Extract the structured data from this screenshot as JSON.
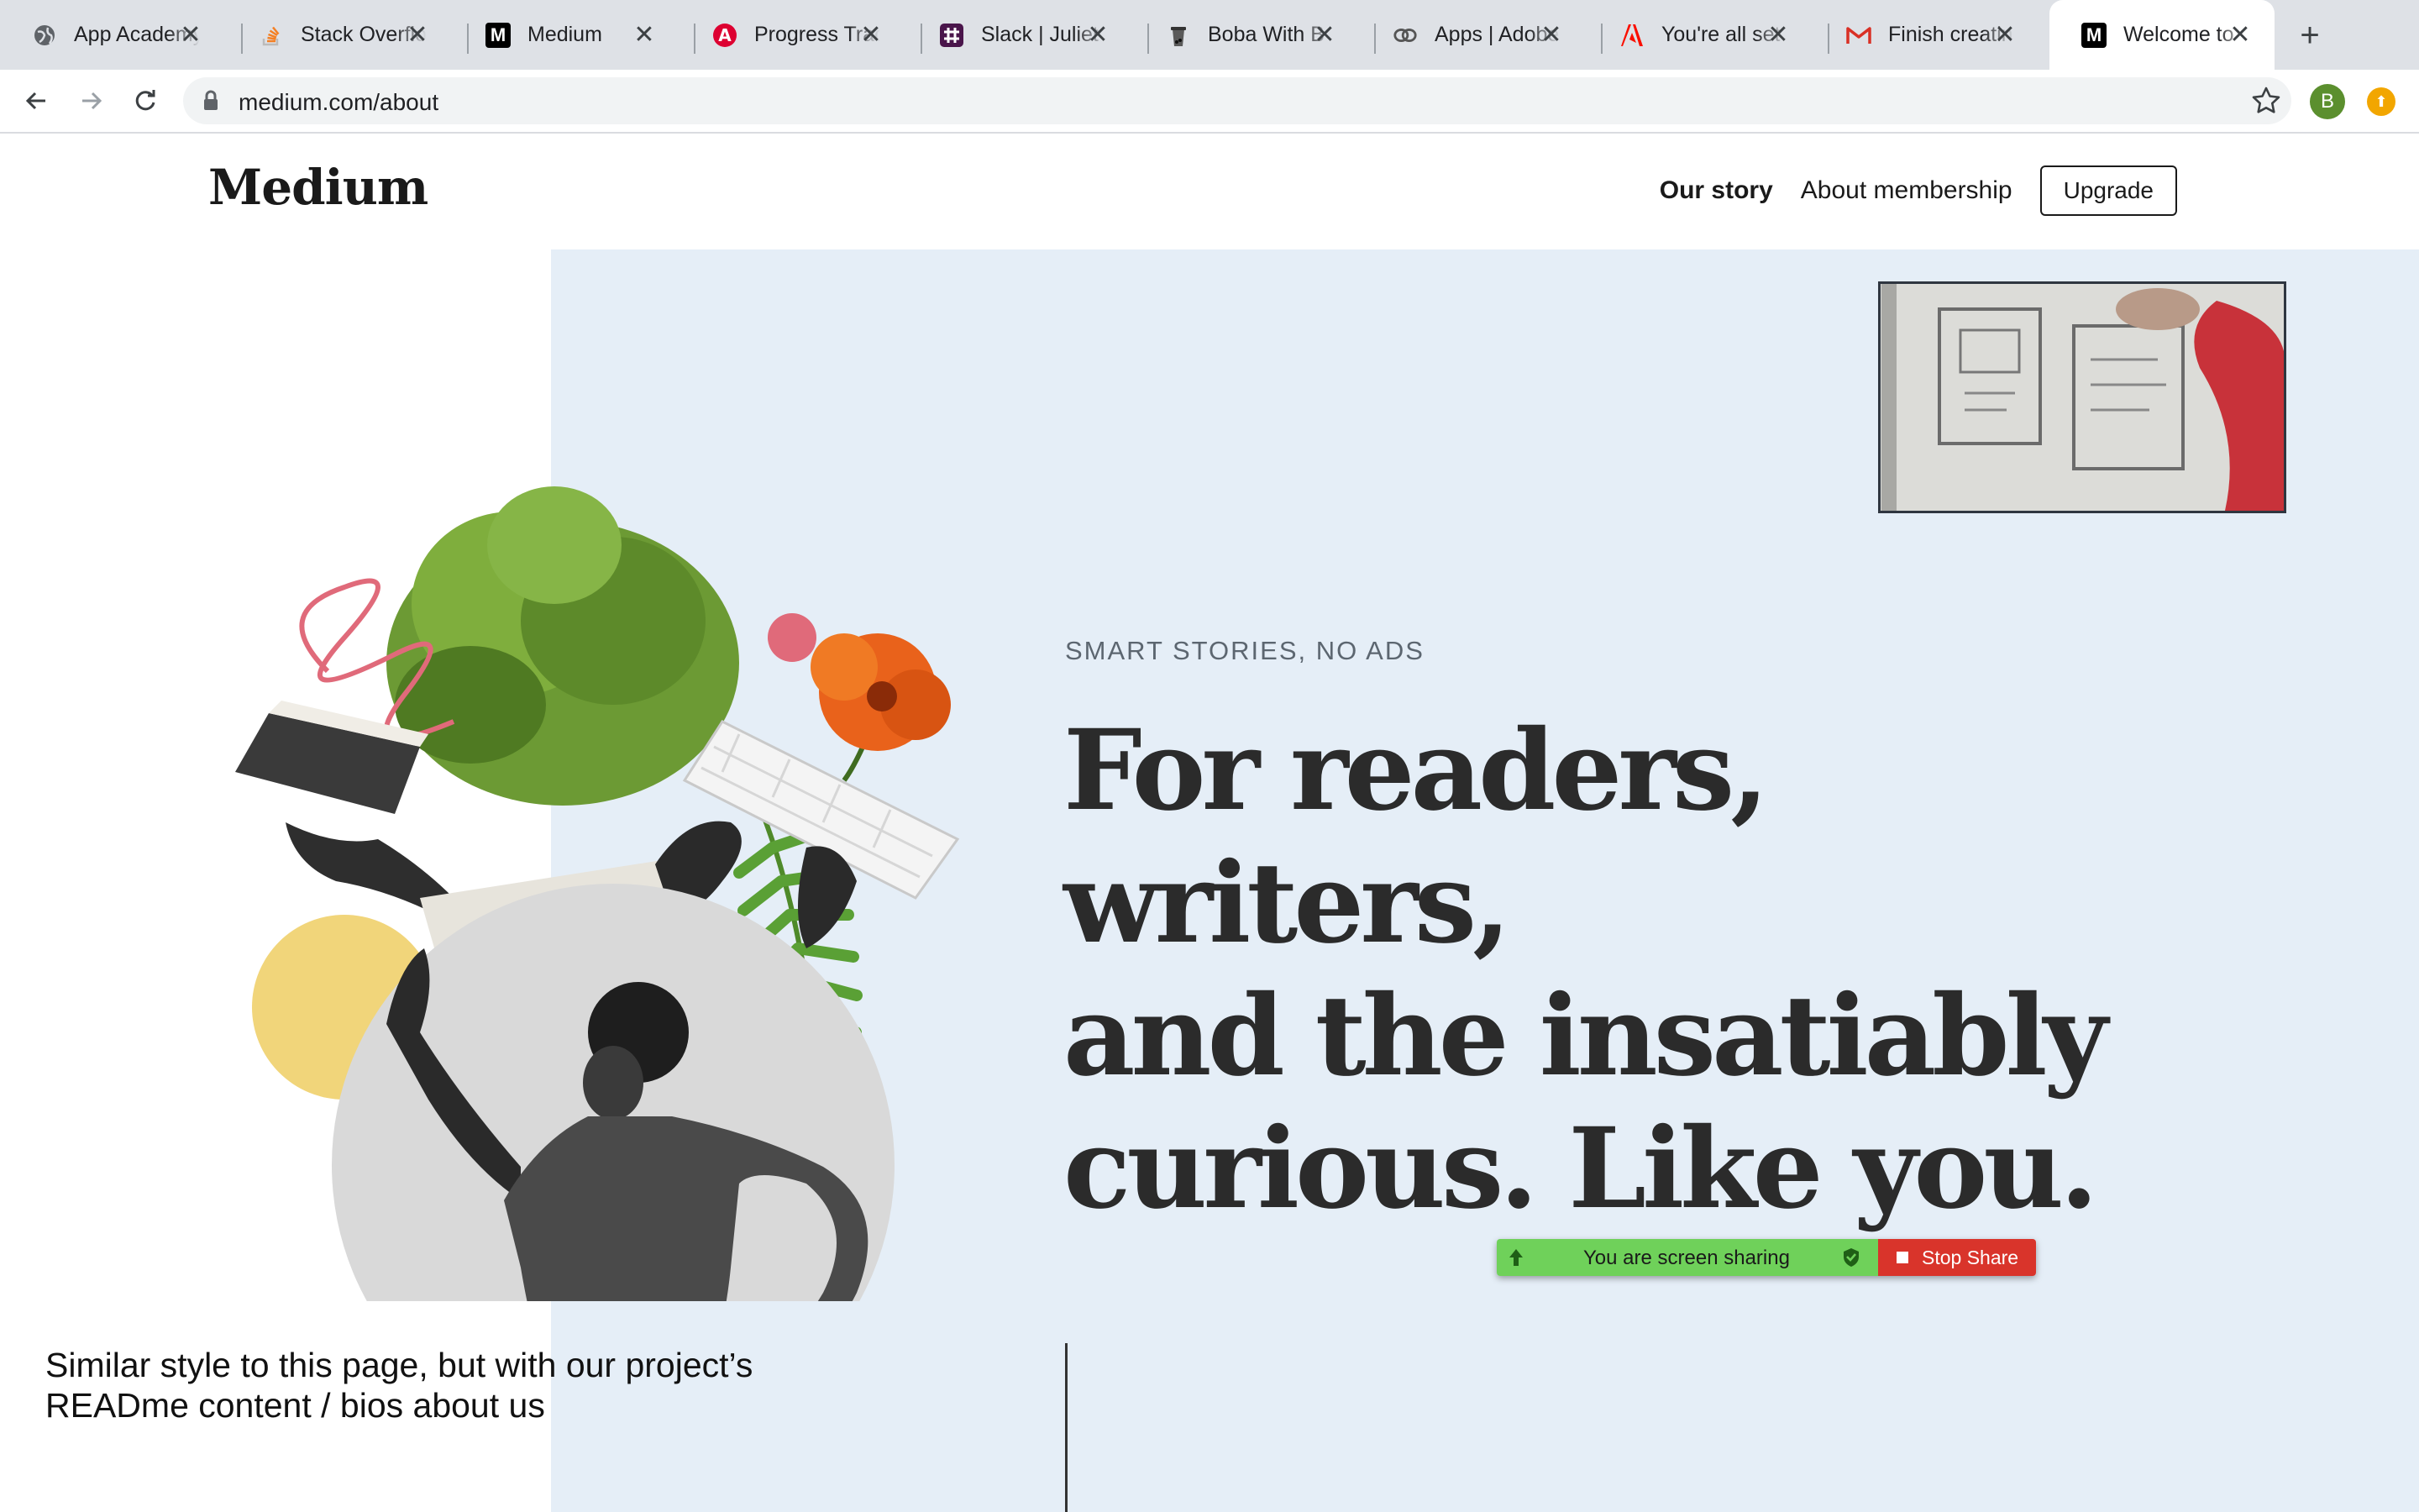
{
  "browser": {
    "tabs": [
      {
        "title": "App Academy",
        "icon": "globe-icon"
      },
      {
        "title": "Stack Overflow",
        "icon": "stackoverflow-icon"
      },
      {
        "title": "Medium",
        "icon": "medium-icon"
      },
      {
        "title": "Progress Tracker",
        "icon": "angular-icon"
      },
      {
        "title": "Slack | Juliet",
        "icon": "slack-icon"
      },
      {
        "title": "Boba With B",
        "icon": "boba-icon"
      },
      {
        "title": "Apps | Adobe",
        "icon": "creative-cloud-icon"
      },
      {
        "title": "You're all set",
        "icon": "adobe-icon"
      },
      {
        "title": "Finish creating",
        "icon": "gmail-icon"
      },
      {
        "title": "Welcome to",
        "icon": "medium-icon",
        "active": true
      }
    ],
    "url": "medium.com/about",
    "profile_initial": "B"
  },
  "site": {
    "logo": "Medium",
    "nav": {
      "our_story": "Our story",
      "membership": "About membership",
      "upgrade": "Upgrade"
    }
  },
  "hero": {
    "eyebrow": "SMART STORIES, NO ADS",
    "headline_lines": [
      "For readers, writers,",
      "and the insatiably",
      "curious. Like you."
    ]
  },
  "screen_share": {
    "status": "You are screen sharing",
    "stop_label": "Stop Share"
  },
  "annotation": {
    "lines": [
      "Similar style to this page, but with our project’s",
      "READme content / bios about us"
    ]
  },
  "colors": {
    "hero_background": "#e5eef7",
    "share_green": "#6fd15a",
    "share_red": "#d9342b",
    "text_dark": "#2b2b2b"
  }
}
